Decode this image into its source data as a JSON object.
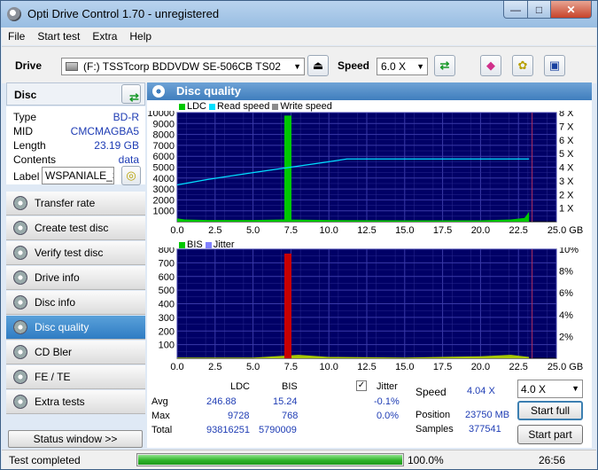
{
  "window": {
    "title": "Opti Drive Control 1.70 - unregistered",
    "min": "—",
    "max": "□",
    "close": "✕"
  },
  "menu": [
    "File",
    "Start test",
    "Extra",
    "Help"
  ],
  "toolbar": {
    "drive_label": "Drive",
    "drive_value": "(F:)  TSSTcorp BDDVDW SE-506CB TS02",
    "speed_label": "Speed",
    "speed_value": "6.0 X"
  },
  "disc": {
    "header": "Disc",
    "type_label": "Type",
    "type_value": "BD-R",
    "mid_label": "MID",
    "mid_value": "CMCMAGBA5",
    "length_label": "Length",
    "length_value": "23.19 GB",
    "contents_label": "Contents",
    "contents_value": "data",
    "label_label": "Label",
    "label_value": "WSPANIALE_SEZONY"
  },
  "nav": [
    "Transfer rate",
    "Create test disc",
    "Verify test disc",
    "Drive info",
    "Disc info",
    "Disc quality",
    "CD Bler",
    "FE / TE",
    "Extra tests"
  ],
  "nav_active": "Disc quality",
  "status_window_btn": "Status window >>",
  "panel_title": "Disc quality",
  "chart_data": [
    {
      "type": "bar",
      "title": "",
      "legend": [
        "LDC",
        "Read speed",
        "Write speed"
      ],
      "colors": {
        "LDC": "#00c800",
        "Read speed": "#00e0ff",
        "Write speed": "#8c8c8c"
      },
      "x_ticks": [
        "0.0",
        "2.5",
        "5.0",
        "7.5",
        "10.0",
        "12.5",
        "15.0",
        "17.5",
        "20.0",
        "22.5",
        "25.0 GB"
      ],
      "y_ticks": [
        "10000",
        "9000",
        "8000",
        "7000",
        "6000",
        "5000",
        "4000",
        "3000",
        "2000",
        "1000"
      ],
      "y2_ticks": [
        "8 X",
        "7 X",
        "6 X",
        "5 X",
        "4 X",
        "3 X",
        "2 X",
        "1 X"
      ],
      "xlim": [
        0,
        25
      ],
      "ylim": [
        0,
        10000
      ],
      "y2lim": [
        0,
        8
      ],
      "spike": {
        "x": 7.3,
        "value": 9728
      },
      "baseline": [
        [
          0,
          300
        ],
        [
          0.5,
          200
        ],
        [
          2,
          150
        ],
        [
          5,
          150
        ],
        [
          7,
          200
        ],
        [
          10,
          150
        ],
        [
          15,
          120
        ],
        [
          20,
          120
        ],
        [
          22,
          200
        ],
        [
          22.9,
          350
        ],
        [
          23.2,
          900
        ]
      ],
      "read_speed": [
        [
          0,
          2.7
        ],
        [
          2,
          3.1
        ],
        [
          5,
          3.6
        ],
        [
          7.5,
          4.0
        ],
        [
          10,
          4.4
        ],
        [
          11.2,
          4.6
        ],
        [
          15,
          4.6
        ],
        [
          20,
          4.6
        ],
        [
          23.2,
          4.6
        ]
      ],
      "marker_x": 23.4
    },
    {
      "type": "bar",
      "title": "",
      "legend": [
        "BIS",
        "Jitter"
      ],
      "colors": {
        "BIS": "#00c800",
        "Jitter": "#8080ff"
      },
      "x_ticks": [
        "0.0",
        "2.5",
        "5.0",
        "7.5",
        "10.0",
        "12.5",
        "15.0",
        "17.5",
        "20.0",
        "22.5",
        "25.0 GB"
      ],
      "y_ticks": [
        "800",
        "700",
        "600",
        "500",
        "400",
        "300",
        "200",
        "100"
      ],
      "y2_ticks": [
        "10%",
        "8%",
        "6%",
        "4%",
        "2%"
      ],
      "xlim": [
        0,
        25
      ],
      "ylim": [
        0,
        800
      ],
      "y2lim": [
        0,
        10
      ],
      "spike": {
        "x": 7.3,
        "value": 768
      },
      "baseline": [
        [
          0,
          5
        ],
        [
          5,
          5
        ],
        [
          8,
          25
        ],
        [
          10,
          10
        ],
        [
          15,
          5
        ],
        [
          20,
          15
        ],
        [
          22,
          25
        ],
        [
          23.2,
          10
        ]
      ],
      "marker_x": 23.4
    }
  ],
  "stats": {
    "col_ldc": "LDC",
    "col_bis": "BIS",
    "col_jitter": "Jitter",
    "avg_label": "Avg",
    "avg_ldc": "246.88",
    "avg_bis": "15.24",
    "avg_jitter": "-0.1%",
    "max_label": "Max",
    "max_ldc": "9728",
    "max_bis": "768",
    "max_jitter": "0.0%",
    "total_label": "Total",
    "total_ldc": "93816251",
    "total_bis": "5790009",
    "speed_label": "Speed",
    "speed_value": "4.04 X",
    "position_label": "Position",
    "position_value": "23750 MB",
    "samples_label": "Samples",
    "samples_value": "377541",
    "speed_select": "4.0 X",
    "start_full": "Start full",
    "start_part": "Start part"
  },
  "status": {
    "text": "Test completed",
    "progress_pct": 100,
    "progress_label": "100.0%",
    "time": "26:56"
  }
}
